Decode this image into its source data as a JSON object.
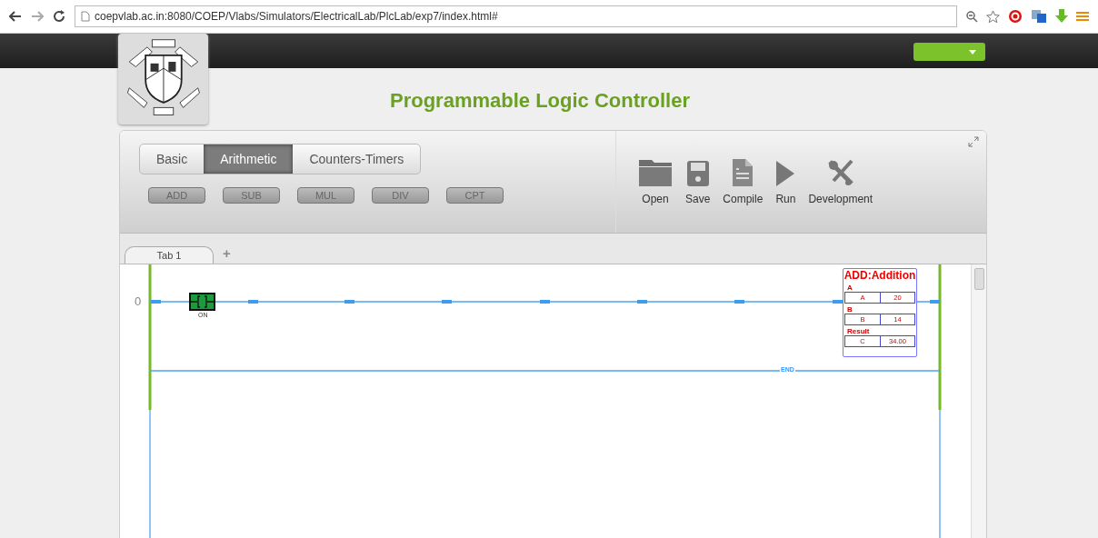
{
  "browser": {
    "url": "coepvlab.ac.in:8080/COEP/Vlabs/Simulators/ElectricalLab/PlcLab/exp7/index.html#"
  },
  "title": "Programmable Logic Controller",
  "category_tabs": [
    {
      "label": "Basic",
      "selected": false
    },
    {
      "label": "Arithmetic",
      "selected": true
    },
    {
      "label": "Counters-Timers",
      "selected": false
    }
  ],
  "instruction_buttons": [
    "ADD",
    "SUB",
    "MUL",
    "DIV",
    "CPT"
  ],
  "toolbar": [
    {
      "kind": "open",
      "label": "Open"
    },
    {
      "kind": "save",
      "label": "Save"
    },
    {
      "kind": "compile",
      "label": "Compile"
    },
    {
      "kind": "run",
      "label": "Run"
    },
    {
      "kind": "development",
      "label": "Development"
    }
  ],
  "sheet_tabs": [
    {
      "label": "Tab 1",
      "selected": true
    }
  ],
  "add_tab": "+",
  "ladder": {
    "rungs": [
      {
        "number": "0",
        "contact": {
          "label": "ON",
          "on": true
        },
        "block": {
          "title": "ADD:Addition",
          "params": [
            {
              "label": "A",
              "name": "A",
              "value": "20"
            },
            {
              "label": "B",
              "name": "B",
              "value": "14"
            },
            {
              "label": "Result",
              "name": "C",
              "value": "34.00"
            }
          ]
        }
      }
    ],
    "end_label": "END"
  }
}
